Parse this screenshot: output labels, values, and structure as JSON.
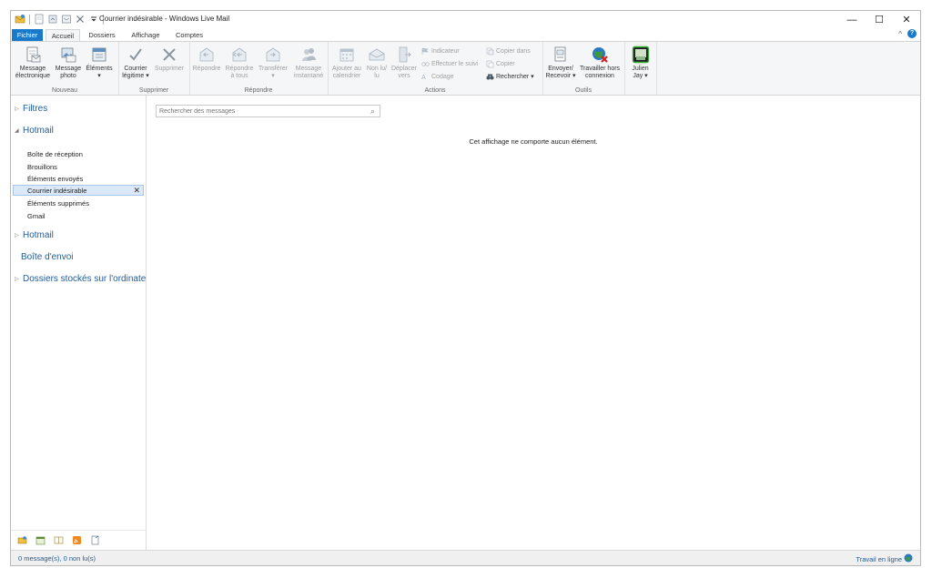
{
  "window": {
    "title": "Courrier indésirable - Windows Live Mail",
    "controls": {
      "minimize": "—",
      "maximize": "☐",
      "close": "✕"
    },
    "quick_access": [
      "mail-app-icon",
      "new-message-icon",
      "reply-icon",
      "send-receive-icon",
      "delete-icon",
      "dropdown-icon"
    ]
  },
  "tabs": {
    "file": "Fichier",
    "items": [
      "Accueil",
      "Dossiers",
      "Affichage",
      "Comptes"
    ],
    "active": "Accueil",
    "collapse": "^",
    "help": "?"
  },
  "ribbon": {
    "nouveau": {
      "caption": "Nouveau",
      "buttons": [
        {
          "line1": "Message",
          "line2": "électronique",
          "icon": "new-email-icon"
        },
        {
          "line1": "Message",
          "line2": "photo",
          "icon": "photo-message-icon"
        },
        {
          "line1": "Éléments",
          "line2": "▾",
          "icon": "items-icon"
        }
      ]
    },
    "supprimer": {
      "caption": "Supprimer",
      "buttons": [
        {
          "line1": "Courrier",
          "line2": "légitime ▾",
          "icon": "checkmark-icon"
        },
        {
          "line1": "Supprimer",
          "line2": "",
          "icon": "delete-icon"
        }
      ]
    },
    "repondre": {
      "caption": "Répondre",
      "buttons": [
        {
          "line1": "Répondre",
          "line2": "",
          "icon": "reply-icon"
        },
        {
          "line1": "Répondre",
          "line2": "à tous",
          "icon": "reply-all-icon"
        },
        {
          "line1": "Transférer",
          "line2": "▾",
          "icon": "forward-icon"
        },
        {
          "line1": "Message",
          "line2": "instantané",
          "icon": "instant-message-icon"
        }
      ]
    },
    "actions": {
      "caption": "Actions",
      "buttons": [
        {
          "line1": "Ajouter au",
          "line2": "calendrier",
          "icon": "calendar-icon"
        },
        {
          "line1": "Non lu/",
          "line2": "lu",
          "icon": "read-unread-icon"
        },
        {
          "line1": "Déplacer",
          "line2": "vers",
          "icon": "move-icon"
        }
      ],
      "small": [
        {
          "label": "Indicateur",
          "icon": "flag-icon"
        },
        {
          "label": "Effectuer le suivi",
          "icon": "follow-up-icon"
        },
        {
          "label": "Codage",
          "icon": "encoding-icon"
        },
        {
          "label": "Copier dans",
          "icon": "copy-to-icon"
        },
        {
          "label": "Copier",
          "icon": "copy-icon"
        },
        {
          "label": "Rechercher ▾",
          "icon": "find-icon"
        }
      ]
    },
    "outils": {
      "caption": "Outils",
      "buttons": [
        {
          "line1": "Envoyer/",
          "line2": "Recevoir ▾",
          "icon": "send-receive-icon"
        },
        {
          "line1": "Travailler hors",
          "line2": "connexion",
          "icon": "work-offline-icon"
        }
      ]
    },
    "user": {
      "line1": "Julien",
      "line2": "Jay ▾",
      "icon": "user-avatar-icon"
    }
  },
  "nav": {
    "filters": "Filtres",
    "account1": "Hotmail",
    "folders": [
      "Boîte de réception",
      "Brouillons",
      "Éléments envoyés",
      "Courrier indésirable",
      "Éléments supprimés",
      "Gmail"
    ],
    "selected": "Courrier indésirable",
    "selected_close": "✕",
    "account2": "Hotmail",
    "outbox": "Boîte d'envoi",
    "local": "Dossiers stockés sur l'ordinate...",
    "bottom_icons": [
      "mail-view-icon",
      "calendar-view-icon",
      "contacts-view-icon",
      "feeds-view-icon",
      "newsgroups-view-icon"
    ]
  },
  "search": {
    "placeholder": "Rechercher des messages"
  },
  "main": {
    "empty_message": "Cet affichage ne comporte aucun élément."
  },
  "status": {
    "left": "0 message(s), 0 non lu(s)",
    "right": "Travail en ligne"
  },
  "colors": {
    "accent": "#1979ca",
    "link": "#1f5c9a",
    "ribbon_bg": "#f5f6f7",
    "selection": "#dbe8f7"
  }
}
